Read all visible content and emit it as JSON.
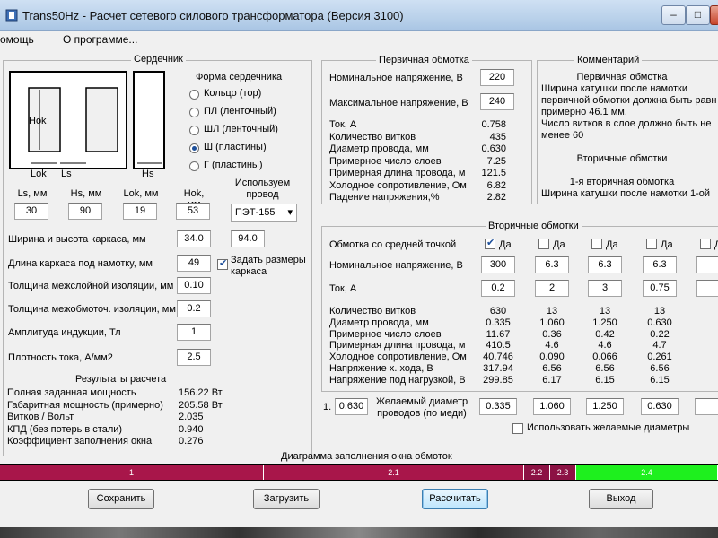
{
  "window": {
    "title": "Trans50Hz - Расчет сетевого силового трансформатора (Версия 3100)",
    "minimize": "–",
    "maximize": "□",
    "close": "✕"
  },
  "menu": [
    "омощь",
    "О программе..."
  ],
  "core": {
    "group_title": "Сердечник",
    "diagram_labels": {
      "hok": "Hok",
      "lok": "Lok",
      "ls": "Ls",
      "hs": "Hs"
    },
    "shape_title": "Форма сердечника",
    "shapes": [
      {
        "label": "Кольцо  (тор)",
        "selected": false
      },
      {
        "label": "ПЛ  (ленточный)",
        "selected": false
      },
      {
        "label": "ШЛ  (ленточный)",
        "selected": false
      },
      {
        "label": "Ш  (пластины)",
        "selected": true
      },
      {
        "label": "Г (пластины)",
        "selected": false
      }
    ],
    "dims": [
      {
        "label": "Ls, мм",
        "value": "30"
      },
      {
        "label": "Hs, мм",
        "value": "90"
      },
      {
        "label": "Lok, мм",
        "value": "19"
      },
      {
        "label": "Hok, мм",
        "value": "53"
      }
    ],
    "wire_label": "Используем провод",
    "wire_value": "ПЭТ-155",
    "params": [
      {
        "label": "Ширина и высота каркаса, мм",
        "value": "34.0"
      },
      {
        "label": "Длина каркаса под намотку, мм",
        "value": "49"
      },
      {
        "label": "Толщина межслойной изоляции, мм",
        "value": "0.10"
      },
      {
        "label": "Толщина межобмоточ. изоляции, мм",
        "value": "0.2"
      },
      {
        "label": "Амплитуда индукции, Тл",
        "value": "1"
      },
      {
        "label": "Плотность тока, А/мм2",
        "value": "2.5"
      }
    ],
    "frame_height": "94.0",
    "set_frame_label": "Задать размеры каркаса",
    "set_frame_checked": true
  },
  "results": {
    "title": "Результаты расчета",
    "rows": [
      {
        "label": "Полная заданная мощность",
        "value": "156.22 Вт"
      },
      {
        "label": "Габаритная мощность (примерно)",
        "value": "205.58 Вт"
      },
      {
        "label": "Витков / Вольт",
        "value": "2.035"
      },
      {
        "label": "КПД (без потерь в стали)",
        "value": "0.940"
      },
      {
        "label": "Коэффициент заполнения окна",
        "value": "0.276"
      }
    ]
  },
  "primary": {
    "title": "Первичная обмотка",
    "nominal_label": "Номинальное напряжение, В",
    "nominal_value": "220",
    "max_label": "Максимальное напряжение, В",
    "max_value": "240",
    "rows": [
      {
        "label": "Ток, А",
        "value": "0.758"
      },
      {
        "label": "Количество витков",
        "value": "435"
      },
      {
        "label": "Диаметр провода, мм",
        "value": "0.630"
      },
      {
        "label": "Примерное число слоев",
        "value": "7.25"
      },
      {
        "label": "Примерная длина провода, м",
        "value": "121.5"
      },
      {
        "label": "Холодное сопротивление, Ом",
        "value": "6.82"
      },
      {
        "label": "Падение напряжения,%",
        "value": "2.82"
      }
    ]
  },
  "comment": {
    "title": "Комментарий",
    "lines": [
      "Первичная обмотка",
      "Ширина катушки после намотки",
      "первичной обмотки должна быть равн",
      "примерно 46.1 мм.",
      "Число витков в слое должно быть не",
      "менее 60",
      "",
      "Вторичные обмотки",
      "",
      "1-я вторичная обмотка",
      "Ширина катушки после намотки 1-ой"
    ]
  },
  "secondary": {
    "title": "Вторичные обмотки",
    "center_tap_label": "Обмотка со средней точкой",
    "checkbox_label": "Да",
    "nominal_label": "Номинальное напряжение, В",
    "current_label": "Ток, А",
    "row_labels": [
      "Количество витков",
      "Диаметр провода, мм",
      "Примерное число слоев",
      "Примерная длина провода, м",
      "Холодное сопротивление, Ом",
      "Напряжение х. хода, В",
      "Напряжение под нагрузкой, В"
    ],
    "columns": [
      {
        "center_tap": true,
        "voltage": "300",
        "current": "0.2",
        "values": [
          "630",
          "0.335",
          "11.67",
          "410.5",
          "40.746",
          "317.94",
          "299.85"
        ],
        "desired": "0.335"
      },
      {
        "center_tap": false,
        "voltage": "6.3",
        "current": "2",
        "values": [
          "13",
          "1.060",
          "0.36",
          "4.6",
          "0.090",
          "6.56",
          "6.17"
        ],
        "desired": "1.060"
      },
      {
        "center_tap": false,
        "voltage": "6.3",
        "current": "3",
        "values": [
          "13",
          "1.250",
          "0.42",
          "4.6",
          "0.066",
          "6.56",
          "6.15"
        ],
        "desired": "1.250"
      },
      {
        "center_tap": false,
        "voltage": "6.3",
        "current": "0.75",
        "values": [
          "13",
          "0.630",
          "0.22",
          "4.7",
          "0.261",
          "6.56",
          "6.15"
        ],
        "desired": "0.630"
      },
      {
        "center_tap": false,
        "voltage": "",
        "current": "",
        "values": [
          "",
          "",
          "",
          "",
          "",
          "",
          ""
        ],
        "desired": ""
      }
    ],
    "desired_label": "Желаемый диаметр проводов  (по меди)",
    "primary_index": "1.",
    "primary_desired": "0.630",
    "use_desired_label": "Использовать желаемые диаметры",
    "use_desired_checked": false
  },
  "fill_diagram": {
    "title": "Диаграмма заполнения окна обмоток",
    "segments": [
      {
        "label": "1",
        "fraction": 0.368,
        "color": "#a8164a"
      },
      {
        "label": "2.1",
        "fraction": 0.362,
        "color": "#a8164a"
      },
      {
        "label": "2.2",
        "fraction": 0.036,
        "color": "#8c1244"
      },
      {
        "label": "2.3",
        "fraction": 0.036,
        "color": "#8c1244"
      },
      {
        "label": "2.4",
        "fraction": 0.198,
        "color": "#1ef01e"
      }
    ]
  },
  "buttons": {
    "save": "Сохранить",
    "load": "Загрузить",
    "calculate": "Рассчитать",
    "exit": "Выход"
  }
}
